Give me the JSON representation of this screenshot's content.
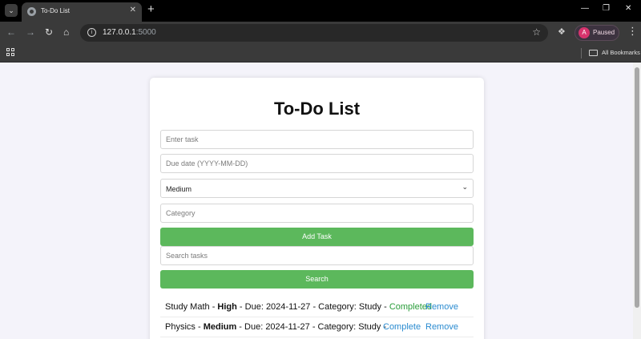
{
  "browser": {
    "tab_title": "To-Do List",
    "url_host": "127.0.0.1",
    "url_port": ":5000",
    "profile_initial": "A",
    "profile_status": "Paused",
    "bookmarks_label": "All Bookmarks"
  },
  "page": {
    "title": "To-Do List",
    "task_placeholder": "Enter task",
    "date_placeholder": "Due date (YYYY-MM-DD)",
    "priority_selected": "Medium",
    "category_placeholder": "Category",
    "add_button": "Add Task",
    "search_placeholder": "Search tasks",
    "search_button": "Search"
  },
  "tasks": [
    {
      "name": "Study Math",
      "priority": "High",
      "due_text": " - Due: 2024-11-27 - Category: Study - ",
      "status": "Completed",
      "remove": "Remove"
    },
    {
      "name": "Physics",
      "priority": "Medium",
      "due_text": " - Due: 2024-11-27 - Category: Study - ",
      "complete": "Complete",
      "remove": "Remove"
    }
  ],
  "colors": {
    "button_green": "#5cb85c",
    "link_blue": "#2a8bd0",
    "completed_green": "#2a9d3a"
  }
}
